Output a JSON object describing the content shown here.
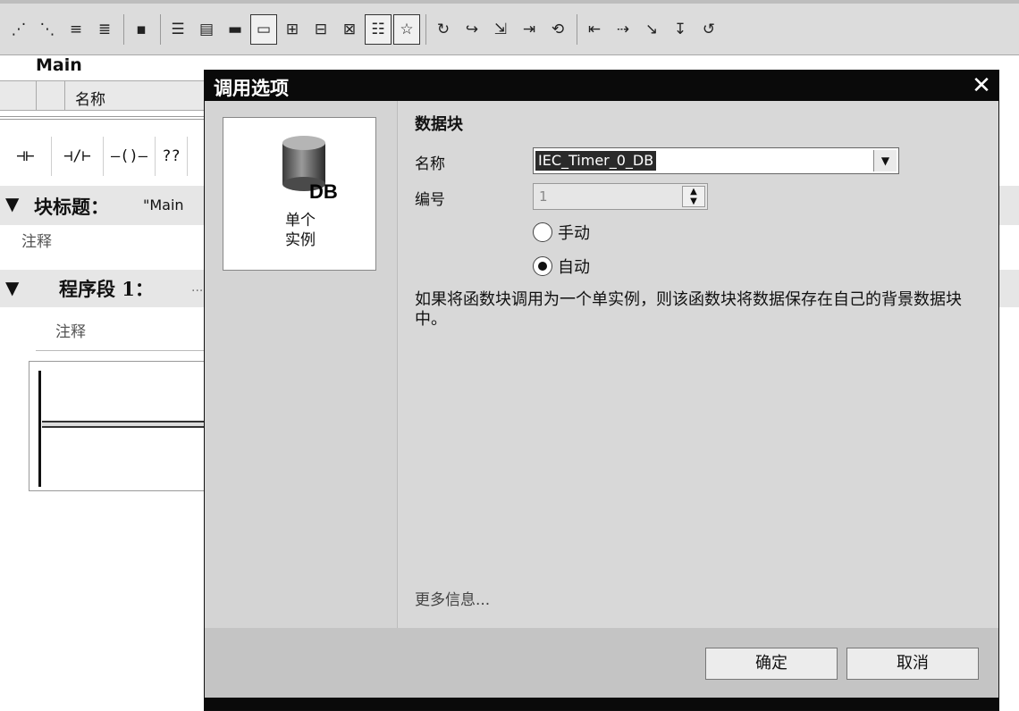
{
  "toolbar": {
    "icons": [
      "insert-network-icon",
      "delete-network-icon",
      "insert-row-icon",
      "add-row-icon",
      "open-branch-icon",
      "absolute-operands-icon",
      "network-expand-icon",
      "network-collapse-icon",
      "comment-icon",
      "comment-toggle-icon",
      "favorites-icon",
      "monitoring-icon"
    ]
  },
  "editor": {
    "block_name": "Main",
    "column_header": "名称",
    "ladder_buttons": [
      "⊣⊢",
      "⊣/⊢",
      "—()—",
      "??"
    ],
    "block_title_label": "块标题：",
    "block_title_value": "\"Main",
    "comment_label": "注释",
    "network_label": "程序段 1：",
    "network_dots": "...",
    "network_comment": "注释"
  },
  "dialog": {
    "title": "调用选项",
    "close_glyph": "✕",
    "option_db_text": "DB",
    "option_label_line1": "单个",
    "option_label_line2": "实例",
    "section_title": "数据块",
    "name_label": "名称",
    "name_value": "IEC_Timer_0_DB",
    "number_label": "编号",
    "number_value": "1",
    "radio_manual": "手动",
    "radio_auto": "自动",
    "radio_selected": "auto",
    "description": "如果将函数块调用为一个单实例，则该函数块将数据保存在自己的背景数据块中。",
    "more_info": "更多信息...",
    "ok_button": "确定",
    "cancel_button": "取消"
  }
}
